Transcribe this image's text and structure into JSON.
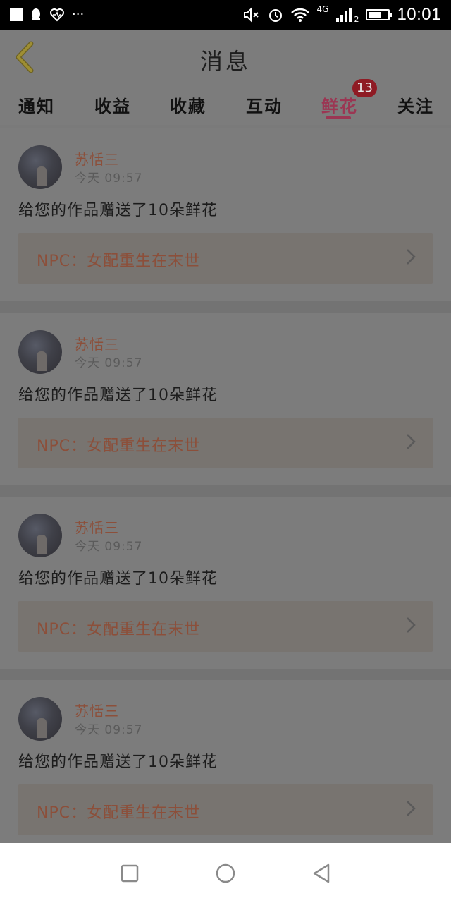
{
  "status_bar": {
    "icons": [
      "notification-square-icon",
      "qq-penguin-icon",
      "health-heart-icon",
      "more-dots-icon"
    ],
    "more_dots": "···",
    "network": "4G",
    "sim_index": "2",
    "time": "10:01",
    "right_icons": [
      "mute-icon",
      "alarm-icon",
      "wifi-icon",
      "signal-icon",
      "battery-icon"
    ],
    "battery_level": 0.55
  },
  "header": {
    "title": "消息",
    "back_icon": "chevron-left-icon",
    "accent": "#b8a23a"
  },
  "tabs": [
    {
      "label": "通知"
    },
    {
      "label": "收益"
    },
    {
      "label": "收藏"
    },
    {
      "label": "互动"
    },
    {
      "label": "鲜花",
      "active": true,
      "badge": "13"
    },
    {
      "label": "关注"
    }
  ],
  "messages": [
    {
      "username": "苏恬三",
      "time": "今天  09:57",
      "text": "给您的作品赠送了10朵鲜花",
      "work_title": "NPC：女配重生在末世"
    },
    {
      "username": "苏恬三",
      "time": "今天  09:57",
      "text": "给您的作品赠送了10朵鲜花",
      "work_title": "NPC：女配重生在末世"
    },
    {
      "username": "苏恬三",
      "time": "今天  09:57",
      "text": "给您的作品赠送了10朵鲜花",
      "work_title": "NPC：女配重生在末世"
    },
    {
      "username": "苏恬三",
      "time": "今天  09:57",
      "text": "给您的作品赠送了10朵鲜花",
      "work_title": "NPC：女配重生在末世"
    }
  ],
  "nav_bar": {
    "buttons": [
      "recent-apps-icon",
      "home-icon",
      "back-triangle-icon"
    ]
  },
  "colors": {
    "accent_pink": "#c0486b",
    "badge_red": "#d2222f",
    "username_orange": "#d4683f"
  }
}
